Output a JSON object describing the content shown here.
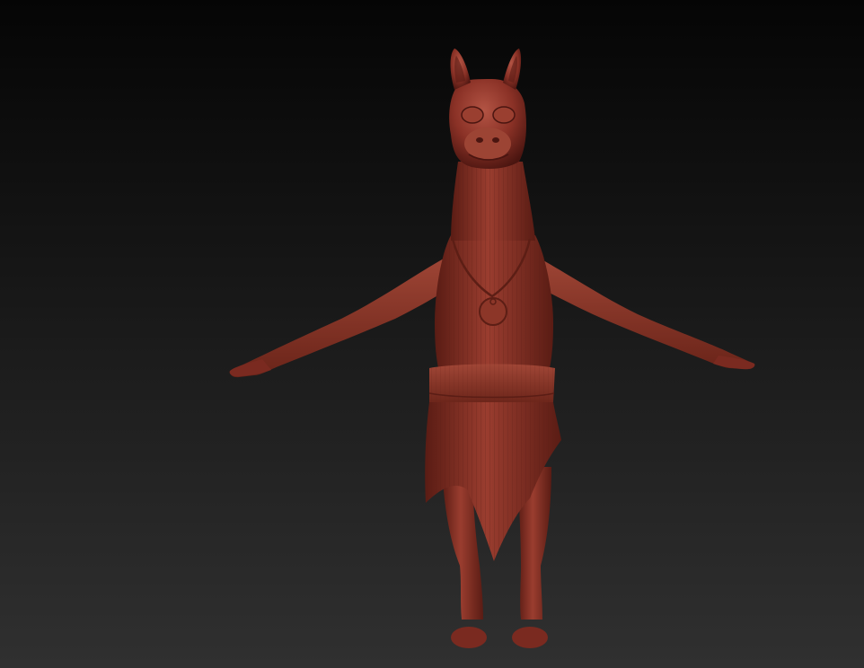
{
  "viewport": {
    "background_top": "#050505",
    "background_bottom": "#303030"
  },
  "model": {
    "subject": "llama-character-icon",
    "material_color": "#8a3126",
    "material_highlight": "#b35444",
    "material_shadow": "#4a1510"
  }
}
